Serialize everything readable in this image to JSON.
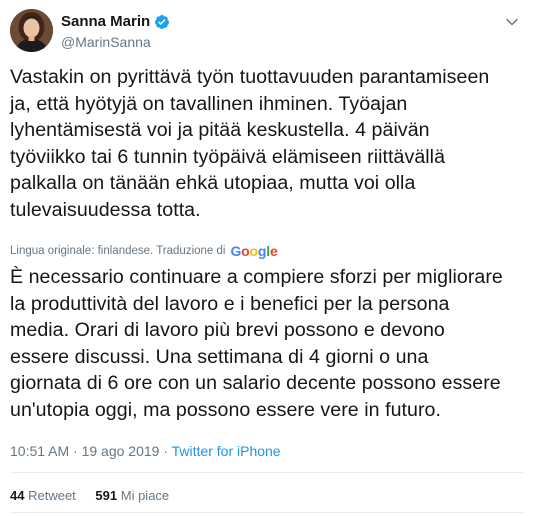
{
  "author": {
    "display_name": "Sanna Marin",
    "handle": "@MarinSanna"
  },
  "icons": {
    "verified": "verified-badge-icon",
    "caret": "chevron-down-icon"
  },
  "tweet": {
    "original_lines": [
      "Vastakin on pyrittävä työn tuottavuuden parantamiseen",
      "ja, että hyötyjä on tavallinen ihminen. Työajan",
      "lyhentämisestä voi ja pitää keskustella. 4 päivän",
      "työviikko tai 6 tunnin työpäivä elämiseen riittävällä",
      "palkalla on tänään ehkä utopiaa, mutta voi olla",
      "tulevaisuudessa totta."
    ],
    "translation_meta": "Lingua originale: finlandese. Traduzione di",
    "translation_provider": "Google",
    "translated_lines": [
      "È necessario continuare a compiere sforzi per migliorare",
      "la produttività del lavoro e i benefici per la persona",
      "media. Orari di lavoro più brevi possono e devono",
      "essere discussi. Una settimana di 4 giorni o una",
      "giornata di 6 ore con un salario decente possono essere",
      "un'utopia oggi, ma possono essere vere in futuro."
    ],
    "timestamp": "10:51 AM · 19 ago 2019",
    "separator": " · ",
    "source": "Twitter for iPhone"
  },
  "stats": {
    "retweets_count": "44",
    "retweets_label": "Retweet",
    "likes_count": "591",
    "likes_label": "Mi piace"
  },
  "colors": {
    "text": "#14171a",
    "secondary": "#657786",
    "link": "#1b95e0",
    "verified": "#1da1f2",
    "divider": "#e6ecf0"
  }
}
